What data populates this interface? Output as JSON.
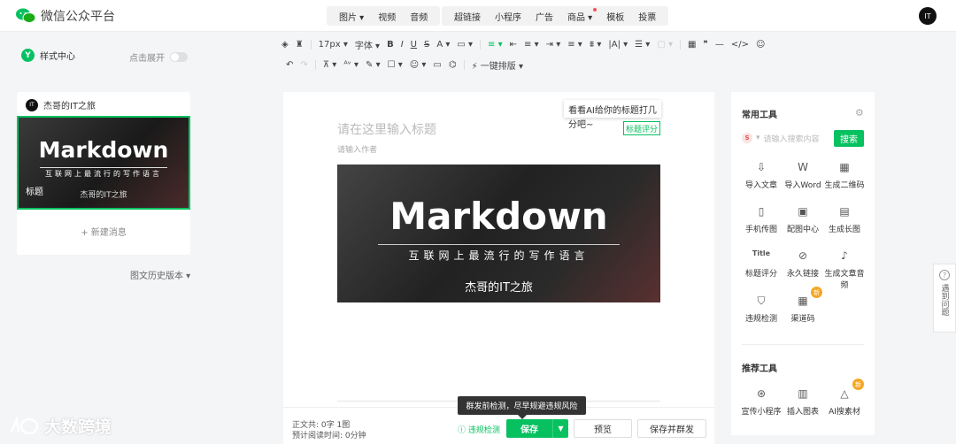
{
  "header": {
    "title": "微信公众平台",
    "menu_group1": [
      "图片",
      "视频",
      "音频"
    ],
    "menu_group2": [
      "超链接",
      "小程序",
      "广告",
      "商品",
      "模板",
      "投票"
    ],
    "avatar": "IT"
  },
  "subbar": {
    "style_center": "样式中心",
    "expand": "点击展开"
  },
  "toolbar": {
    "row1": [
      "◈",
      "♜",
      "17px",
      "字体",
      "B",
      "I",
      "U",
      "S",
      "A",
      "▭",
      "≡",
      "⇤",
      "≡",
      "⇥",
      "≡",
      "⩩",
      "|A|",
      "☰",
      "▢",
      "▦",
      "❞",
      "—",
      "</>",
      "☺"
    ],
    "row2": [
      "↶",
      "↷",
      "⊼",
      "ᴬᵛ",
      "✎",
      "☐",
      "☺",
      "▭",
      "⌬"
    ],
    "auto_layout": "一键排版"
  },
  "left": {
    "account": "杰哥的IT之旅",
    "thumb_title": "Markdown",
    "thumb_sub": "互联网上最流行的写作语言",
    "thumb_caption": "标题",
    "thumb_author": "杰哥的IT之旅",
    "new_msg": "新建消息",
    "history": "图文历史版本"
  },
  "editor": {
    "title_placeholder": "请在这里输入标题",
    "author_placeholder": "请输入作者",
    "tip_line1": "看看AI给你的标题打几",
    "tip_line2": "分吧~",
    "score_btn": "标题评分",
    "cover_title": "Markdown",
    "cover_sub": "互联网上最流行的写作语言",
    "cover_author": "杰哥的IT之旅"
  },
  "bottom": {
    "stat_body": "正文共:  0字 1图",
    "stat_time": "预计阅读时间:  0分钟",
    "check": "违规检测",
    "save": "保存",
    "preview": "预览",
    "save_send": "保存并群发",
    "tooltip": "群发前检测，尽早规避违规风险"
  },
  "right": {
    "common_tools": "常用工具",
    "search_placeholder": "请输入搜索内容",
    "search_btn": "搜索",
    "tools": [
      {
        "label": "导入文章",
        "icon": "⇩"
      },
      {
        "label": "导入Word",
        "icon": "W"
      },
      {
        "label": "生成二维码",
        "icon": "▦"
      },
      {
        "label": "手机传图",
        "icon": "▯"
      },
      {
        "label": "配图中心",
        "icon": "▣"
      },
      {
        "label": "生成长图",
        "icon": "▤"
      },
      {
        "label": "标题评分",
        "icon": "Title"
      },
      {
        "label": "永久链接",
        "icon": "⊘"
      },
      {
        "label": "生成文章音频",
        "icon": "♪"
      },
      {
        "label": "违规检测",
        "icon": "⛉"
      },
      {
        "label": "渠道码",
        "icon": "▦"
      }
    ],
    "recommended": "推荐工具",
    "rec_tools": [
      {
        "label": "宣传小程序",
        "icon": "⊛"
      },
      {
        "label": "插入图表",
        "icon": "▥"
      },
      {
        "label": "AI搜素材",
        "icon": "△"
      }
    ],
    "new_badge": "新"
  },
  "sidetab": {
    "label": "遇到问题"
  },
  "watermark": "大数跨境"
}
